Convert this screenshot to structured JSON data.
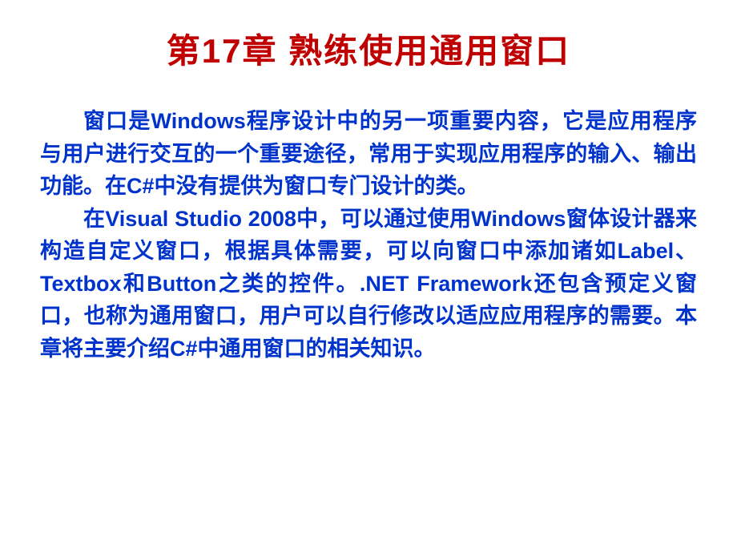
{
  "slide": {
    "title": "第17章  熟练使用通用窗口",
    "paragraph1": "窗口是Windows程序设计中的另一项重要内容，它是应用程序与用户进行交互的一个重要途径，常用于实现应用程序的输入、输出功能。在C#中没有提供为窗口专门设计的类。",
    "paragraph2": "在Visual Studio 2008中，可以通过使用Windows窗体设计器来构造自定义窗口，根据具体需要，可以向窗口中添加诸如Label、Textbox和Button之类的控件。.NET Framework还包含预定义窗口，也称为通用窗口，用户可以自行修改以适应应用程序的需要。本章将主要介绍C#中通用窗口的相关知识。"
  }
}
